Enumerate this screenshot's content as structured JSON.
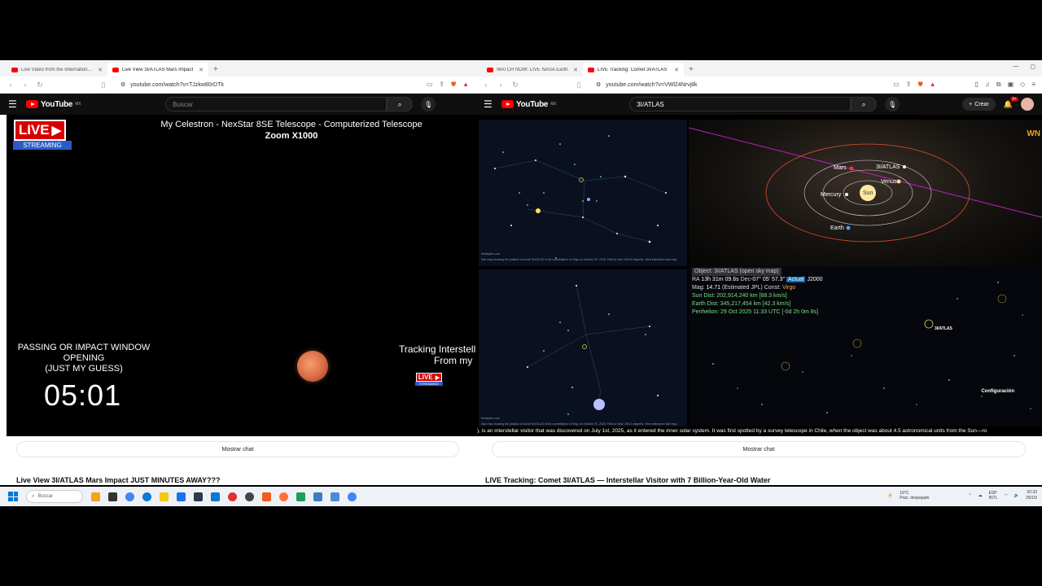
{
  "left_window": {
    "tabs": [
      {
        "label": "Live Video from the International Sp"
      },
      {
        "label": "Live View 3I/ATLAS Mars Impact"
      }
    ],
    "url": "youtube.com/watch?v=TJzkw80rDTk",
    "yt_country": "MX",
    "search_placeholder": "Buscar",
    "video": {
      "live_label": "LIVE",
      "streaming_label": "STREAMING",
      "title_line1": "My Celestron - NexStar 8SE Telescope - Computerized Telescope",
      "title_line2": "Zoom X1000",
      "passing_line1": "PASSING OR IMPACT WINDOW",
      "passing_line2": "OPENING",
      "passing_line3": "(JUST MY GUESS)",
      "timer": "05:01",
      "tracking_line1": "Tracking Interstell",
      "tracking_line2": "From my",
      "small_live_label": "LIVE",
      "small_streaming_label": "STREAMING"
    },
    "chat_button": "Mostrar chat",
    "video_title": "Live View 3I/ATLAS Mars Impact JUST MINUTES AWAY???"
  },
  "right_window": {
    "tabs": [
      {
        "label": "WATCH NOW: LIVE NASA Earth"
      },
      {
        "label": "LIVE Tracking: Comet 3I/ATLAS"
      }
    ],
    "url": "youtube.com/watch?v=VWl24Nrvj8k",
    "yt_country": "MX",
    "search_value": "3I/ATLAS",
    "crear_label": "Crear",
    "notif_count": "9+",
    "orbit_labels": {
      "mars": "Mars",
      "atlas": "3I/ATLAS",
      "venus": "Venus",
      "mercury": "Mercury",
      "sun": "Sun",
      "earth": "Earth"
    },
    "channel_logo": "WN",
    "info": {
      "object_line": "Object: 3I/ATLAS    (open sky map)",
      "ra_prefix": "RA",
      "ra_value": "13h 31m 09.6s",
      "dec_prefix": "Dec",
      "dec_value": "-07° 05' 57.3\"",
      "epoch_tag": "Actual",
      "epoch": "J2000",
      "mag_prefix": "Mag:",
      "mag_value": "14.71",
      "mag_note": "(Estimated JPL)",
      "const_prefix": "Const:",
      "const_value": "Virgo",
      "sun_dist_prefix": "Sun Dist:",
      "sun_dist_value": "202,914,240 km [68.3 km/s]",
      "earth_dist_prefix": "Earth Dist:",
      "earth_dist_value": "345,217,454 km [42.3 km/s]",
      "perihelion_prefix": "Perihelion:",
      "perihelion_value": "29 Oct 2025 11:33 UTC [-0d 2h 0m 8s]"
    },
    "starmap_top_caption": "Star map showing the position of comet 3I/ATLAS in the constellation of Virgo on October 29, 2025. Field of view: 50x30 degrees. View interactive star map.",
    "starmap_bottom_caption": "Star map showing the position of comet 3I/ATLAS in the constellation of Virgo on October 29, 2025. Field of view: 15x10 degrees. View interactive star map.",
    "site_credit": "theskylive.com",
    "atlas_marker": "3I/ATLAS",
    "config_label": "Configuración",
    "ticker": "), is an interstellar visitor that was discovered on July 1st, 2025, as it entered the inner solar system. It was first spotted by a survey telescope in Chile, when the object was about 4.5 astronomical units from the Sun—ro",
    "chat_button": "Mostrar chat",
    "video_title": "LIVE Tracking: Comet 3I/ATLAS — Interstellar Visitor with 7 Billion-Year-Old Water"
  },
  "taskbar": {
    "search_placeholder": "Buscar",
    "weather_temp": "16°C",
    "weather_desc": "Prac. despejado",
    "lang_line1": "ESP",
    "lang_line2": "INTL",
    "time": "02:33",
    "date": "29/10/"
  }
}
